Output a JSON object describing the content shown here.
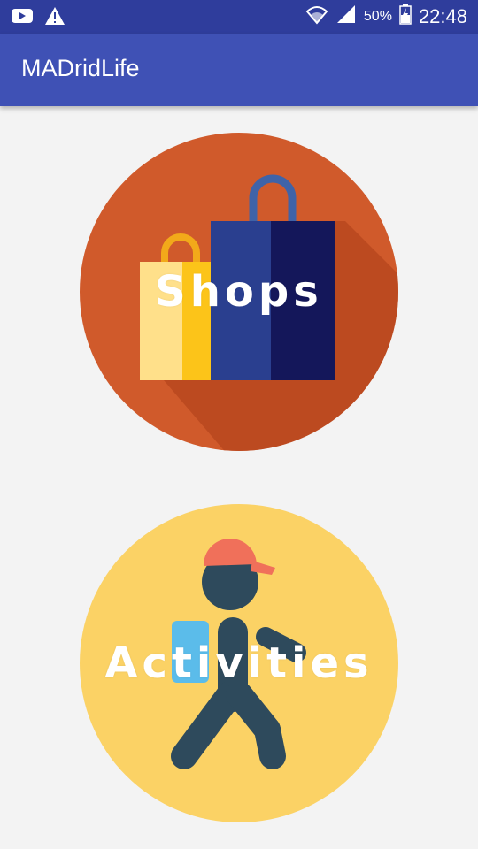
{
  "status_bar": {
    "battery": "50%",
    "time": "22:48",
    "icons": [
      "youtube-icon",
      "warning-icon",
      "wifi-icon",
      "signal-icon",
      "battery-icon"
    ]
  },
  "app_bar": {
    "title": "MADridLife"
  },
  "menu": {
    "items": [
      {
        "label": "Shops",
        "icon": "shopping-bags-icon",
        "background": "#d05a2b"
      },
      {
        "label": "Activities",
        "icon": "walking-person-icon",
        "background": "#fbd265"
      }
    ]
  },
  "colors": {
    "status_bar": "#2f3d9c",
    "app_bar": "#3f51b5",
    "background": "#f3f3f3"
  }
}
